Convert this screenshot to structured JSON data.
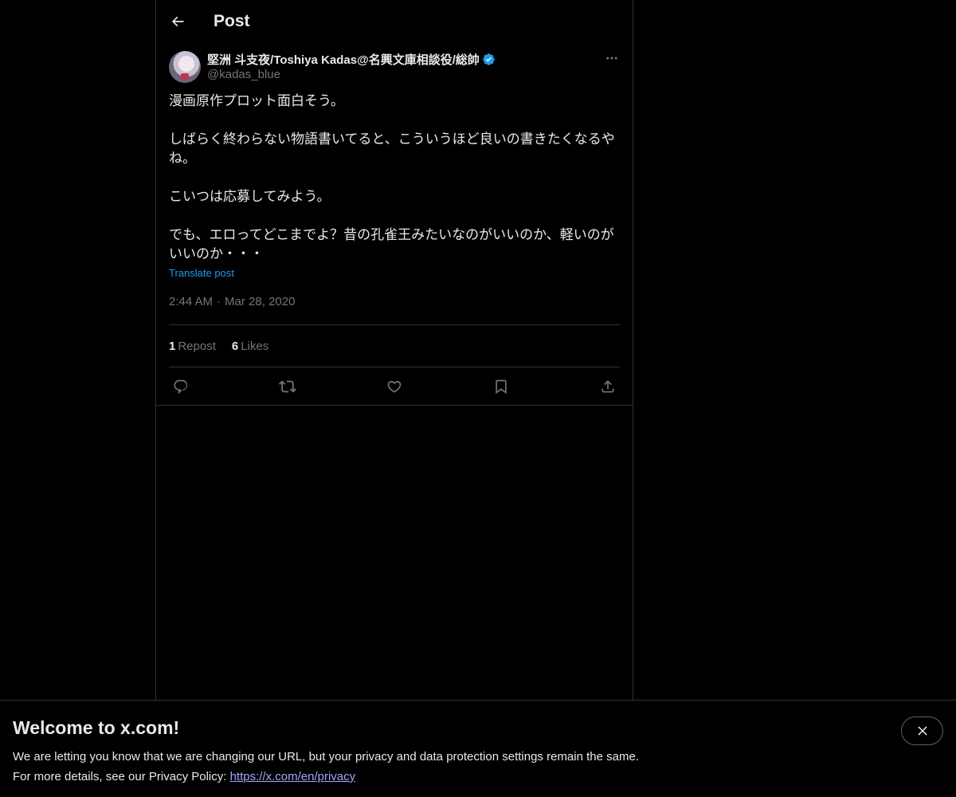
{
  "header": {
    "title": "Post",
    "back_icon": "arrow-left-icon"
  },
  "post": {
    "author": {
      "display_name": "堅洲 斗支夜/Toshiya Kadas@名興文庫相談役/総帥",
      "handle": "@kadas_blue",
      "verified": true
    },
    "text": "漫画原作プロット面白そう。\n\nしばらく終わらない物語書いてると、こういうほど良いの書きたくなるや\nね。\n\nこいつは応募してみよう。\n\nでも、エロってどこまでよ？昔の孔雀王みたいなのがいいのか、軽いのが\nいいのか・・・",
    "translate_label": "Translate post",
    "time": "2:44 AM",
    "separator": "·",
    "date": "Mar 28, 2020",
    "stats": {
      "reposts_count": "1",
      "reposts_label": "Repost",
      "likes_count": "6",
      "likes_label": "Likes"
    },
    "actions": [
      "reply-icon",
      "repost-icon",
      "like-icon",
      "bookmark-icon",
      "share-icon"
    ]
  },
  "banner": {
    "title": "Welcome to x.com!",
    "line1": "We are letting you know that we are changing our URL, but your privacy and data protection settings remain the same.",
    "line2_prefix": "For more details, see our Privacy Policy: ",
    "link_text": "https://x.com/en/privacy"
  },
  "colors": {
    "background": "#000000",
    "text": "#e7e9ea",
    "muted": "#71767b",
    "accent": "#1d9bf0",
    "border": "#2f3336",
    "link": "#a3a5f8"
  }
}
